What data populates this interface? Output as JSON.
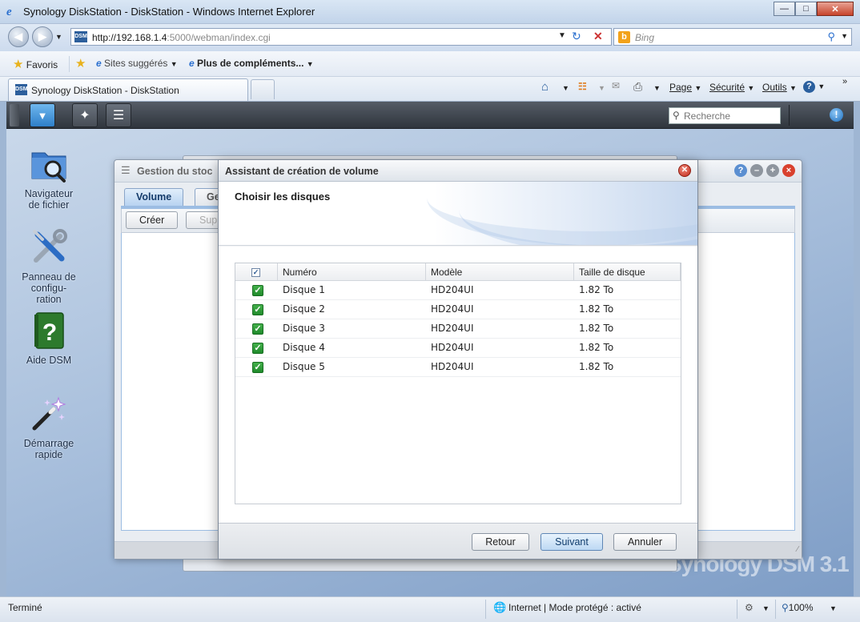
{
  "browser": {
    "window_title": "Synology DiskStation - DiskStation - Windows Internet Explorer",
    "url_host": "http://192.168.1.4",
    "url_rest": ":5000/webman/index.cgi",
    "search_placeholder": "Bing",
    "favorites_label": "Favoris",
    "suggested_sites_label": "Sites suggérés",
    "more_addons_label": "Plus de compléments...",
    "tab_title": "Synology DiskStation - DiskStation",
    "commands": {
      "page": "Page",
      "security": "Sécurité",
      "tools": "Outils"
    }
  },
  "dsm": {
    "search_placeholder": "Recherche",
    "desktop_icons": [
      {
        "line1": "Navigateur",
        "line2": "de fichier",
        "line3": ""
      },
      {
        "line1": "Panneau de",
        "line2": "configu-",
        "line3": "ration"
      },
      {
        "line1": "Aide DSM",
        "line2": "",
        "line3": ""
      },
      {
        "line1": "Démarrage",
        "line2": "rapide",
        "line3": ""
      }
    ],
    "watermark": "Synology DSM 3.1"
  },
  "storage_window": {
    "title": "Gestion du stoc",
    "tabs": [
      "Volume",
      "Ge"
    ],
    "buttons": {
      "create": "Créer",
      "delete": "Sup"
    }
  },
  "wizard": {
    "title": "Assistant de création de volume",
    "step_title": "Choisir les disques",
    "columns": {
      "number": "Numéro",
      "model": "Modèle",
      "size": "Taille de disque"
    },
    "disks": [
      {
        "name": "Disque 1",
        "model": "HD204UI",
        "size": "1.82 To"
      },
      {
        "name": "Disque 2",
        "model": "HD204UI",
        "size": "1.82 To"
      },
      {
        "name": "Disque 3",
        "model": "HD204UI",
        "size": "1.82 To"
      },
      {
        "name": "Disque 4",
        "model": "HD204UI",
        "size": "1.82 To"
      },
      {
        "name": "Disque 5",
        "model": "HD204UI",
        "size": "1.82 To"
      }
    ],
    "buttons": {
      "back": "Retour",
      "next": "Suivant",
      "cancel": "Annuler"
    }
  },
  "status": {
    "left": "Terminé",
    "zone": "Internet | Mode protégé : activé",
    "zoom": "100%"
  }
}
